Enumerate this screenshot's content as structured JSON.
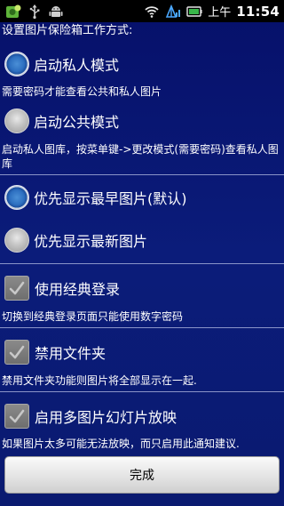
{
  "status_bar": {
    "ampm": "上午",
    "time": "11:54",
    "icons": [
      "app-notification-icon",
      "usb-icon",
      "android-debug-icon",
      "wifi-icon",
      "signal-icon",
      "battery-icon"
    ]
  },
  "header": {
    "title": "设置图片保险箱工作方式:"
  },
  "mode_group": {
    "private_label": "启动私人模式",
    "private_selected": true,
    "private_desc": "需要密码才能查看公共和私人图片",
    "public_label": "启动公共模式",
    "public_selected": false,
    "public_desc": "启动私人图库，按菜单键->更改模式(需要密码)查看私人图库"
  },
  "order_group": {
    "earliest_label": "优先显示最早图片(默认)",
    "earliest_selected": true,
    "latest_label": "优先显示最新图片",
    "latest_selected": false
  },
  "options": {
    "classic_login_label": "使用经典登录",
    "classic_login_checked": true,
    "classic_login_desc": "切换到经典登录页面只能使用数字密码",
    "disable_folders_label": "禁用文件夹",
    "disable_folders_checked": true,
    "disable_folders_desc": "禁用文件夹功能则图片将全部显示在一起.",
    "slideshow_label": "启用多图片幻灯片放映",
    "slideshow_checked": true,
    "slideshow_desc": "如果图片太多可能无法放映，而只启用此通知建议."
  },
  "footer": {
    "done_label": "完成"
  },
  "colors": {
    "background": "#0b1c7a",
    "status_bar": "#000000",
    "divider": "#8a94c8",
    "radio_selected": "#2d6fc0"
  }
}
